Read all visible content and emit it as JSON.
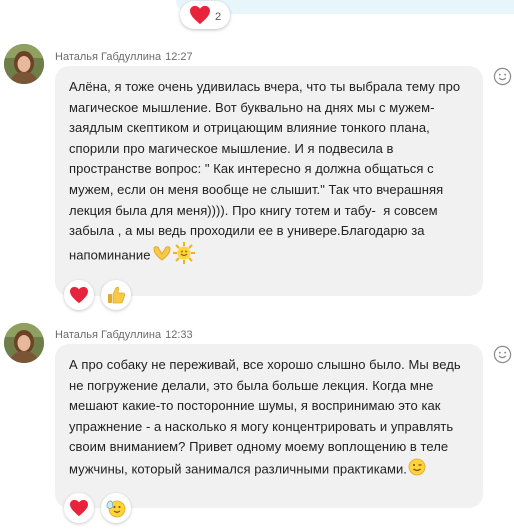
{
  "top": {
    "reaction_icon": "heart-icon",
    "reaction_count": "2",
    "accent_color": "#e6f6fb"
  },
  "messages": [
    {
      "author": "Наталья Габдуллина",
      "time": "12:27",
      "text": "Алёна, я тоже очень удивилась вчера, что ты выбрала тему про магическое мышление. Вот буквально на днях мы с мужем-заядлым скептиком и отрицающим влияние тонкого плана, спорили про магическое мышление. И я подвесила в пространстве вопрос: \" Как интересно я должна общаться с мужем, если он меня вообще не слышит.\" Так что вчерашняя лекция была для меня)))). Про книгу тотем и табу-  я совсем забыла , а мы ведь проходили ее в универе.Благодарю за напоминание",
      "lines": [
        "Алёна, я тоже очень удивилась вчера, что ты выбрала тему про",
        "магическое мышление. Вот буквально на днях мы с мужем-",
        "заядлым скептиком и отрицающим влияние тонкого плана,",
        "спорили про магическое мышление. И я подвесила в",
        "пространстве вопрос: \" Как интересно я должна общаться с",
        "мужем, если он меня вообще не слышит.\" Так что вчерашняя",
        "лекция была для меня)))). Про книгу тотем и табу-  я совсем",
        "забыла , а мы ведь проходили ее в универе.Благодарю за",
        "напоминание"
      ],
      "trailing_emojis": [
        "heart-hands-icon",
        "sun-face-icon"
      ],
      "reactions": [
        "heart-icon",
        "thumbs-up-icon"
      ]
    },
    {
      "author": "Наталья Габдуллина",
      "time": "12:33",
      "lines": [
        "А про собаку не переживай, все хорошо слышно было. Мы ведь",
        "не погружение делали, это была больше лекция. Когда мне",
        "мешают какие-то посторонние шумы, я воспринимаю это как",
        "упражнение - а насколько я могу концентрировать и управлять",
        "своим вниманием? Привет одному моему воплощению в теле",
        "мужчины, который занимался различными практиками."
      ],
      "trailing_emojis": [
        "winking-face-icon"
      ],
      "reactions": [
        "heart-icon",
        "clapping-face-icon"
      ]
    }
  ],
  "colors": {
    "bubble": "#f1f1f1",
    "heart": "#e8233c",
    "meta_text": "#6b6b6b"
  }
}
